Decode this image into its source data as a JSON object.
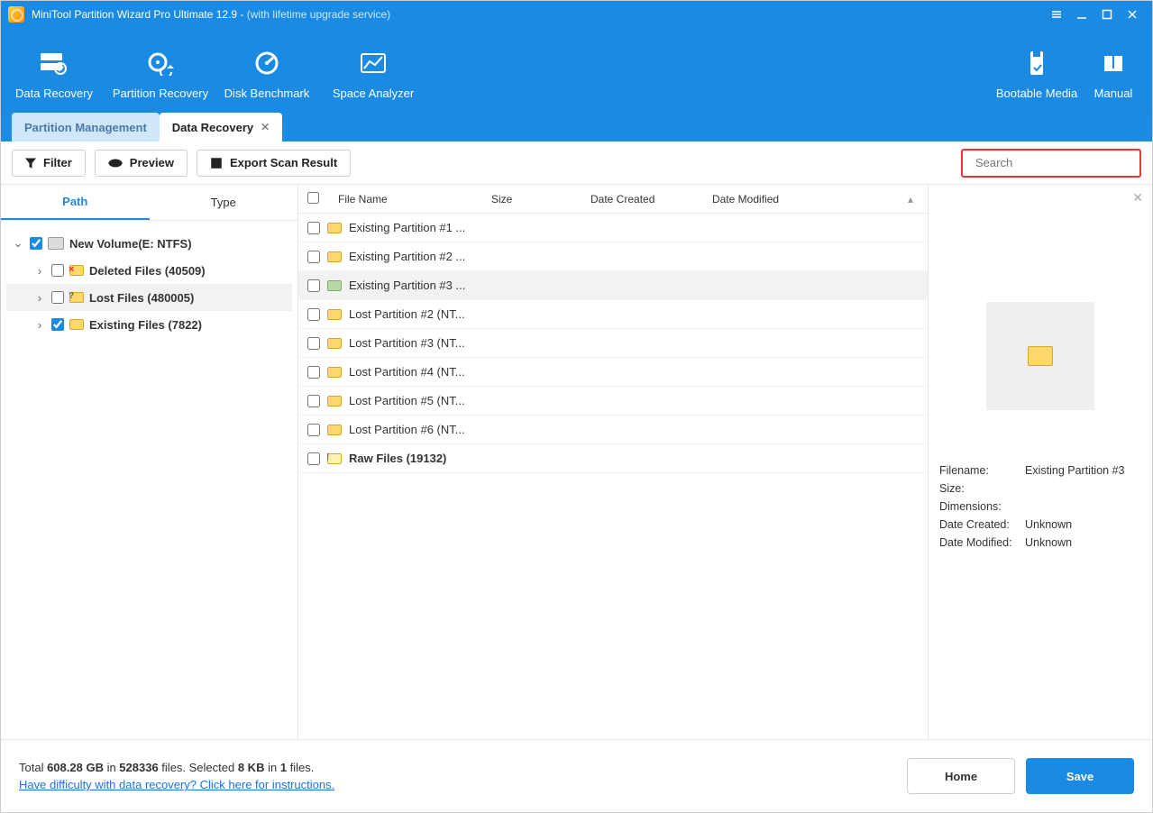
{
  "titlebar": {
    "title_main": "MiniTool Partition Wizard Pro Ultimate 12.9 -",
    "title_sub": "(with lifetime upgrade service)"
  },
  "toolbar": {
    "data_recovery": "Data Recovery",
    "partition_recovery": "Partition Recovery",
    "disk_benchmark": "Disk Benchmark",
    "space_analyzer": "Space Analyzer",
    "bootable_media": "Bootable Media",
    "manual": "Manual"
  },
  "tabs": {
    "partition_management": "Partition Management",
    "data_recovery": "Data Recovery"
  },
  "actions": {
    "filter": "Filter",
    "preview": "Preview",
    "export": "Export Scan Result",
    "search_placeholder": "Search"
  },
  "sidetabs": {
    "path": "Path",
    "type": "Type"
  },
  "tree": {
    "root": "New Volume(E: NTFS)",
    "deleted": "Deleted Files (40509)",
    "lost": "Lost Files (480005)",
    "existing": "Existing Files (7822)"
  },
  "columns": {
    "name": "File Name",
    "size": "Size",
    "created": "Date Created",
    "modified": "Date Modified"
  },
  "rows": [
    {
      "name": "Existing Partition #1 ...",
      "icon": "folder",
      "bold": false
    },
    {
      "name": "Existing Partition #2 ...",
      "icon": "folder",
      "bold": false
    },
    {
      "name": "Existing Partition #3 ...",
      "icon": "folder-green",
      "bold": false,
      "selected": true
    },
    {
      "name": "Lost Partition #2 (NT...",
      "icon": "folder",
      "bold": false
    },
    {
      "name": "Lost Partition #3 (NT...",
      "icon": "folder",
      "bold": false
    },
    {
      "name": "Lost Partition #4 (NT...",
      "icon": "folder",
      "bold": false
    },
    {
      "name": "Lost Partition #5 (NT...",
      "icon": "folder",
      "bold": false
    },
    {
      "name": "Lost Partition #6 (NT...",
      "icon": "folder",
      "bold": false
    },
    {
      "name": "Raw Files (19132)",
      "icon": "folder-raw",
      "bold": true
    }
  ],
  "preview": {
    "filename_k": "Filename:",
    "filename_v": "Existing Partition #3",
    "size_k": "Size:",
    "size_v": "",
    "dim_k": "Dimensions:",
    "dim_v": "",
    "created_k": "Date Created:",
    "created_v": "Unknown",
    "modified_k": "Date Modified:",
    "modified_v": "Unknown"
  },
  "bottom": {
    "stats_prefix": "Total ",
    "total_size": "608.28 GB",
    "in1": " in ",
    "total_files": "528336",
    "files_word": " files.  Selected ",
    "sel_size": "8 KB",
    "in2": " in ",
    "sel_count": "1",
    "files_word2": " files.",
    "help_link": "Have difficulty with data recovery? Click here for instructions.",
    "home": "Home",
    "save": "Save"
  }
}
